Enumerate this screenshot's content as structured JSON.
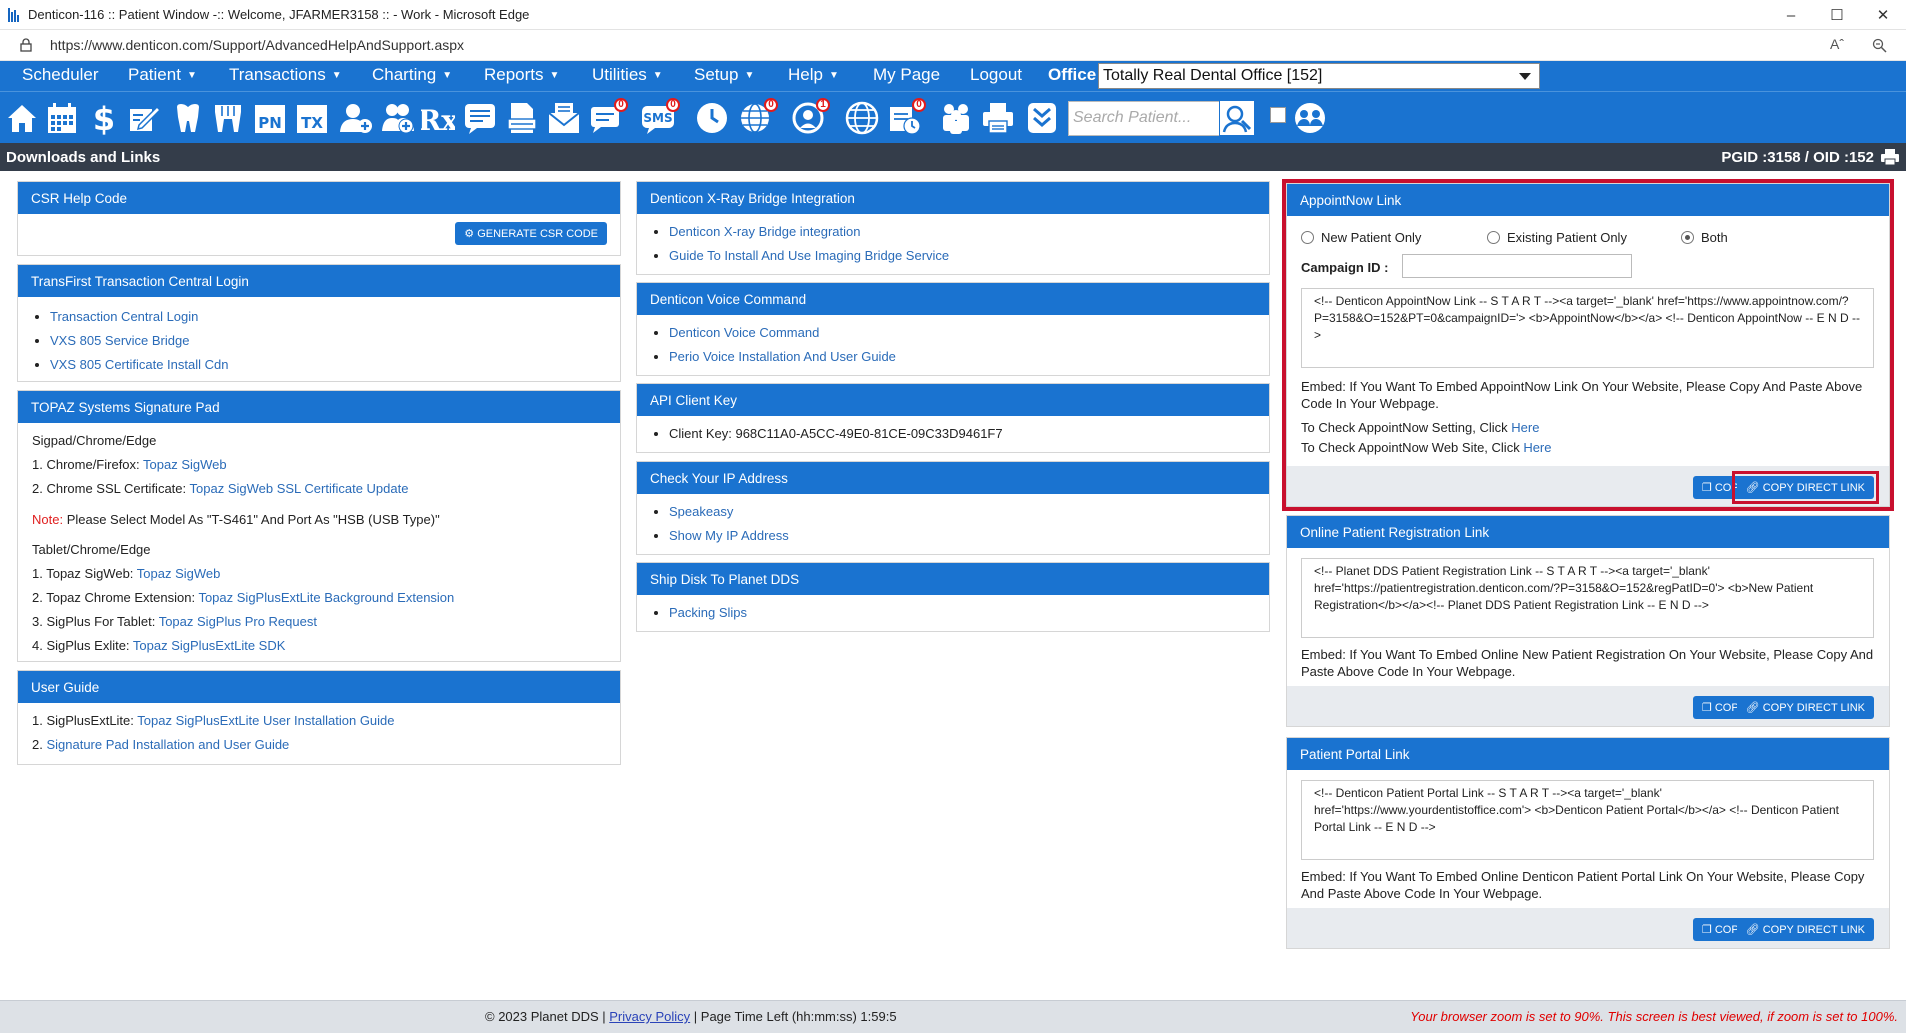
{
  "window": {
    "title": "Denticon-116 :: Patient Window -:: Welcome, JFARMER3158 :: - Work - Microsoft Edge",
    "url": "https://www.denticon.com/Support/AdvancedHelpAndSupport.aspx"
  },
  "menu": {
    "items": [
      {
        "label": "Scheduler",
        "caret": ""
      },
      {
        "label": "Patient",
        "caret": "▼"
      },
      {
        "label": "Transactions",
        "caret": "▼"
      },
      {
        "label": "Charting",
        "caret": "▼"
      },
      {
        "label": "Reports",
        "caret": "▼"
      },
      {
        "label": "Utilities",
        "caret": "▼"
      },
      {
        "label": "Setup",
        "caret": "▼"
      },
      {
        "label": "Help",
        "caret": "▼"
      },
      {
        "label": "My Page",
        "caret": ""
      },
      {
        "label": "Logout",
        "caret": ""
      }
    ],
    "office_label": "Office",
    "office_value": "Totally Real Dental Office [152]"
  },
  "toolbar": {
    "search_placeholder": "Search Patient...",
    "rx_label": "Rx",
    "pn_label": "PN",
    "tx_label": "TX",
    "sms_label": "SMS",
    "badges": {
      "sms": "0",
      "notes": "0",
      "globe": "0",
      "recall": "1",
      "schedule": "0"
    }
  },
  "page": {
    "title": "Downloads and Links",
    "ids": "PGID :3158  /  OID :152"
  },
  "csr": {
    "title": "CSR Help Code",
    "button": "GENERATE CSR CODE"
  },
  "transfirst": {
    "title": "TransFirst Transaction Central Login",
    "links": [
      "Transaction Central Login",
      "VXS 805 Service Bridge",
      "VXS 805 Certificate Install Cdn"
    ]
  },
  "topaz": {
    "title": "TOPAZ Systems Signature Pad",
    "section1": "Sigpad/Chrome/Edge",
    "l1_prefix": "1. Chrome/Firefox: ",
    "l1_link": "Topaz SigWeb",
    "l2_prefix": "2. Chrome SSL Certificate: ",
    "l2_link": "Topaz SigWeb SSL Certificate Update",
    "note_label": "Note:",
    "note_text": " Please Select Model As \"T-S461\" And Port As \"HSB (USB Type)\"",
    "section2": "Tablet/Chrome/Edge",
    "t1_prefix": "1. Topaz SigWeb: ",
    "t1_link": "Topaz SigWeb",
    "t2_prefix": "2. Topaz Chrome Extension: ",
    "t2_link": "Topaz SigPlusExtLite Background Extension",
    "t3_prefix": "3. SigPlus For Tablet: ",
    "t3_link": "Topaz SigPlus Pro Request",
    "t4_prefix": "4. SigPlus Exlite: ",
    "t4_link": "Topaz SigPlusExtLite SDK"
  },
  "userguide": {
    "title": "User Guide",
    "g1_prefix": "1. SigPlusExtLite: ",
    "g1_link": "Topaz SigPlusExtLite User Installation Guide",
    "g2_prefix": "2. ",
    "g2_link": "Signature Pad Installation and User Guide"
  },
  "xray": {
    "title": "Denticon X-Ray Bridge Integration",
    "links": [
      "Denticon X-ray Bridge integration",
      "Guide To Install And Use Imaging Bridge Service"
    ]
  },
  "voice": {
    "title": "Denticon Voice Command",
    "links": [
      "Denticon Voice Command",
      "Perio Voice Installation And User Guide"
    ]
  },
  "api": {
    "title": "API Client Key",
    "key_text": "Client Key: 968C11A0-A5CC-49E0-81CE-09C33D9461F7"
  },
  "ip": {
    "title": "Check Your IP Address",
    "links": [
      "Speakeasy",
      "Show My IP Address"
    ]
  },
  "ship": {
    "title": "Ship Disk To Planet DDS",
    "links": [
      "Packing Slips"
    ]
  },
  "appointnow": {
    "title": "AppointNow Link",
    "radio_new": "New Patient Only",
    "radio_existing": "Existing Patient Only",
    "radio_both": "Both",
    "campaign_label": "Campaign ID :",
    "code": "<!-- Denticon AppointNow Link --  S T A R T --><a target='_blank' href='https://www.appointnow.com/?P=3158&O=152&PT=0&campaignID='> <b>AppointNow</b></a> <!-- Denticon AppointNow --  E N D -->",
    "embed": "Embed: If You Want To Embed AppointNow Link On Your Website, Please Copy And Paste Above Code In Your Webpage.",
    "check1_prefix": "To Check AppointNow Setting, Click ",
    "check2_prefix": "To Check AppointNow Web Site, Click ",
    "here": "Here",
    "copy": "COPY",
    "copy_direct": "COPY DIRECT LINK"
  },
  "registration": {
    "title": "Online Patient Registration Link",
    "code": "<!-- Planet DDS Patient Registration Link --  S T A R T --><a target='_blank' href='https://patientregistration.denticon.com/?P=3158&O=152&regPatID=0'> <b>New Patient Registration</b></a><!-- Planet DDS Patient Registration Link --  E N D -->",
    "embed": "Embed: If You Want To Embed Online New Patient Registration On Your Website, Please Copy And Paste Above Code In Your Webpage.",
    "copy": "COPY",
    "copy_direct": "COPY DIRECT LINK"
  },
  "portal": {
    "title": "Patient Portal Link",
    "code": "<!-- Denticon Patient Portal Link --  S T A R T --><a target='_blank' href='https://www.yourdentistoffice.com'> <b>Denticon Patient Portal</b></a> <!-- Denticon Patient Portal Link --  E N D -->",
    "embed": "Embed: If You Want To Embed Online Denticon Patient Portal Link On Your Website, Please Copy And Paste Above Code In Your Webpage.",
    "copy": "COPY",
    "copy_direct": "COPY DIRECT LINK"
  },
  "footer": {
    "copyright": "© 2023 Planet DDS | ",
    "privacy": "Privacy Policy",
    "time_left": " | Page Time Left (hh:mm:ss) 1:59:5",
    "zoom": "Your browser zoom is set to 90%. This screen is best viewed, if zoom is set to 100%."
  },
  "colors": {
    "brand": "#1a73d0",
    "header": "#343d4a",
    "highlight": "#c8102e",
    "link": "#2a6bb8"
  }
}
